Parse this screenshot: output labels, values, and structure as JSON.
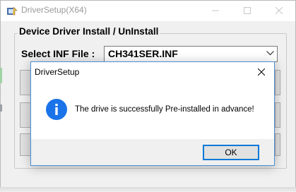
{
  "main_window": {
    "title": "DriverSetup(X64)",
    "group_title": "Device Driver Install / UnInstall",
    "inf_label": "Select INF File :",
    "inf_selected": "CH341SER.INF"
  },
  "dialog": {
    "title": "DriverSetup",
    "message": "The drive is successfully Pre-installed in advance!",
    "ok_label": "OK",
    "icon": "info-icon"
  },
  "colors": {
    "accent": "#0078d7",
    "info_icon": "#1a73e8"
  }
}
